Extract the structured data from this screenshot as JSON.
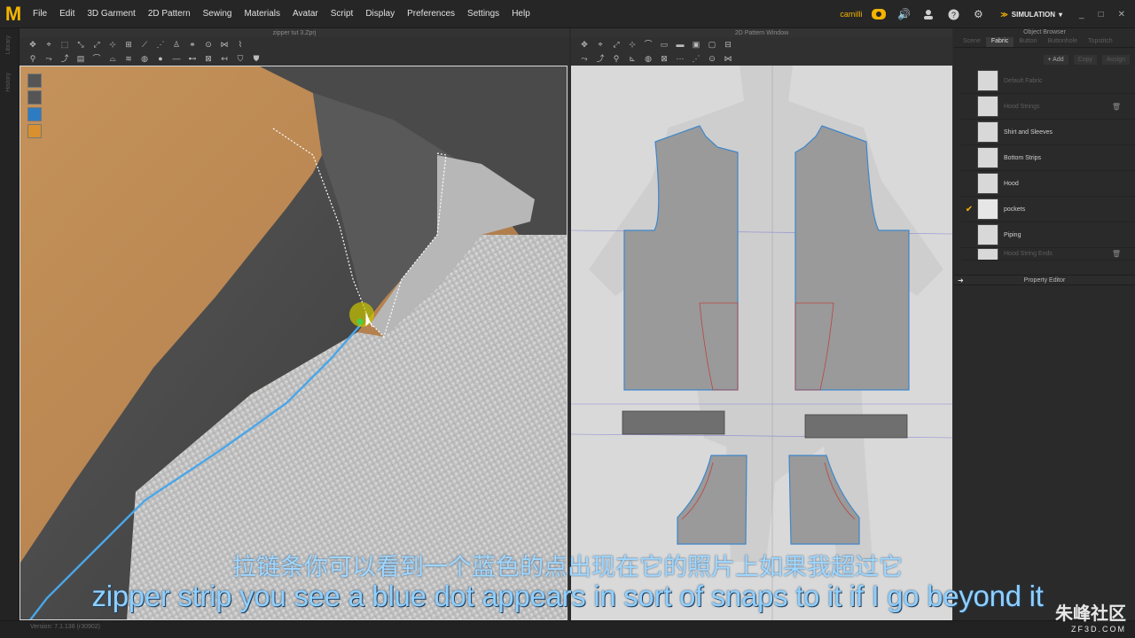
{
  "app": {
    "logo": "M",
    "menu": [
      "File",
      "Edit",
      "3D Garment",
      "2D Pattern",
      "Sewing",
      "Materials",
      "Avatar",
      "Script",
      "Display",
      "Preferences",
      "Settings",
      "Help"
    ],
    "user": "camilli",
    "mode": "SIMULATION",
    "window_controls": [
      "_",
      "□",
      "✕"
    ]
  },
  "window3d": {
    "title": "zipper tut 3.Zprj"
  },
  "window2d": {
    "title": "2D Pattern Window"
  },
  "object_browser": {
    "title": "Object Browser",
    "tabs": [
      "Scene",
      "Fabric",
      "Button",
      "Buttonhole",
      "Topstitch"
    ],
    "active_tab": "Fabric",
    "actions": {
      "add": "+ Add",
      "copy": "Copy",
      "assign": "Assign"
    },
    "fabrics": [
      {
        "name": "Default Fabric",
        "dim": true,
        "checked": false,
        "trash": false
      },
      {
        "name": "Hood Strings",
        "dim": true,
        "checked": false,
        "trash": true
      },
      {
        "name": "Shirt and Sleeves",
        "dim": false,
        "checked": false,
        "trash": false
      },
      {
        "name": "Bottom Strips",
        "dim": false,
        "checked": false,
        "trash": false
      },
      {
        "name": "Hood",
        "dim": false,
        "checked": false,
        "trash": false
      },
      {
        "name": "pockets",
        "dim": false,
        "checked": true,
        "trash": false
      },
      {
        "name": "Piping",
        "dim": false,
        "checked": false,
        "trash": false
      },
      {
        "name": "Hood String Ends",
        "dim": true,
        "checked": false,
        "trash": true
      }
    ]
  },
  "property_editor": {
    "title": "Property Editor"
  },
  "statusbar": {
    "text": "Version: 7.1.138    (r30902)"
  },
  "subtitles": {
    "chinese": "拉链条你可以看到一个蓝色的点出现在它的照片上如果我超过它",
    "english": "zipper strip you see a blue dot appears in sort of snaps to it if I go beyond it"
  },
  "watermark": {
    "main": "朱峰社区",
    "sub": "ZF3D.COM"
  },
  "colors": {
    "accent": "#f4b400",
    "seam_blue": "#4aa6e8",
    "subtitle": "#8fd0ff"
  }
}
